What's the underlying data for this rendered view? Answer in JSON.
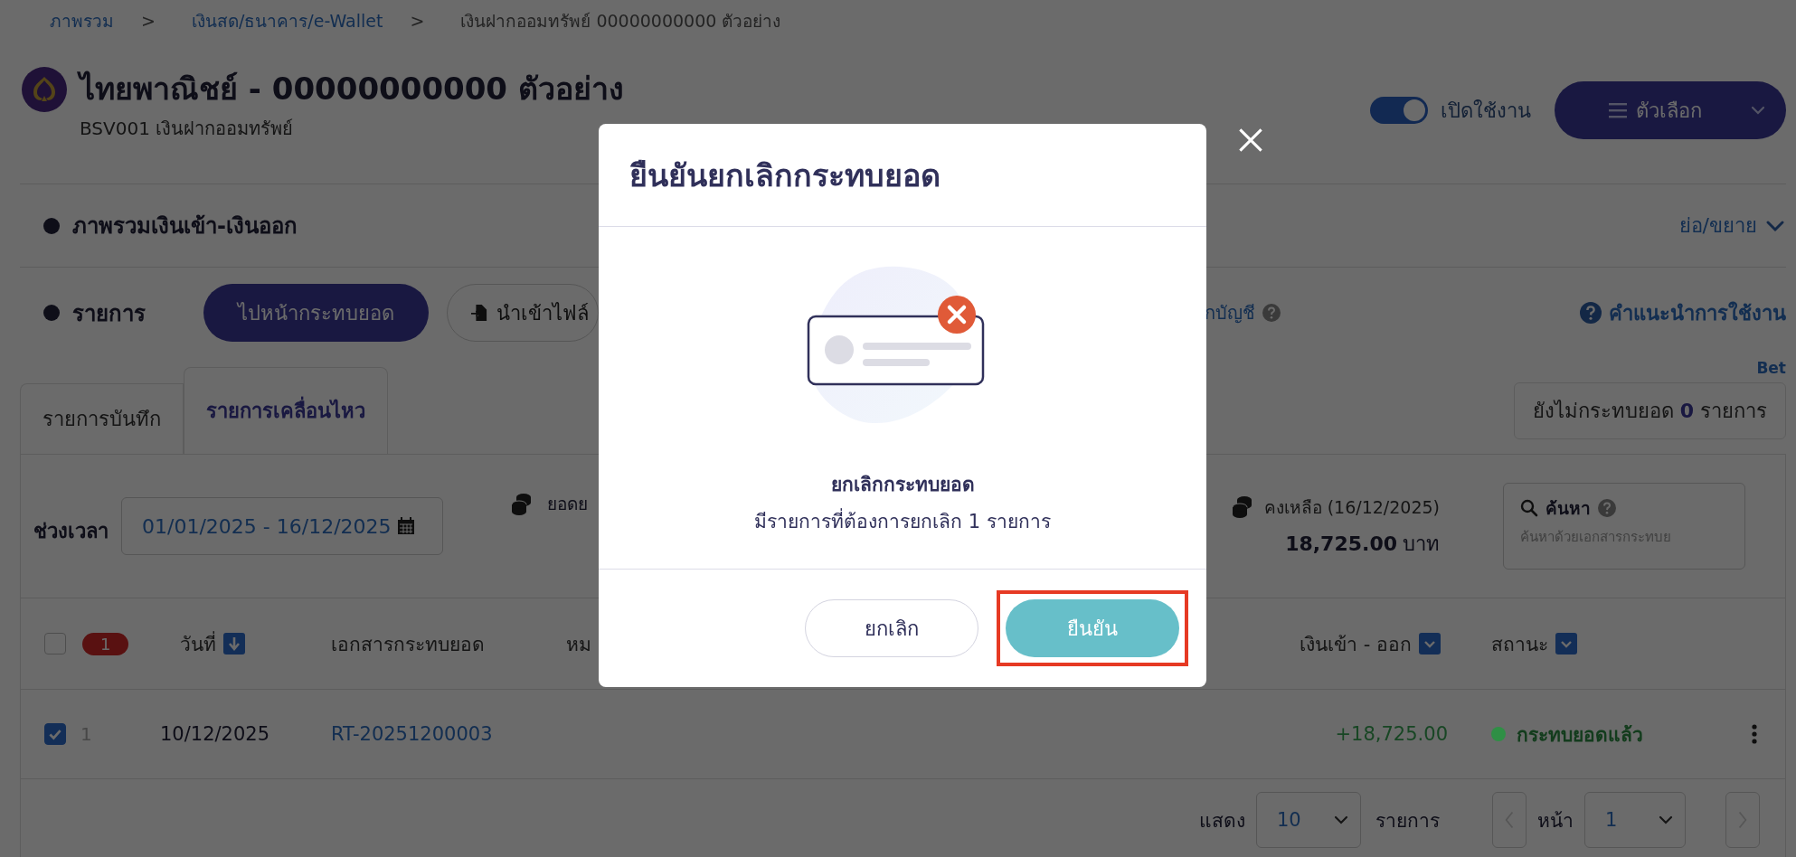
{
  "breadcrumb": [
    {
      "label": "ภาพรวม",
      "link": true
    },
    {
      "label": "เงินสด/ธนาคาร/e-Wallet",
      "link": true,
      "separator": ">"
    },
    {
      "label": "เงินฝากออมทรัพย์ 00000000000 ตัวอย่าง",
      "link": false,
      "separator": ">"
    }
  ],
  "account": {
    "title": "ไทยพาณิชย์ - 00000000000 ตัวอย่าง",
    "subtitle": "BSV001 เงินฝากออมทรัพย์"
  },
  "status_toggle": {
    "label": "เปิดใช้งาน",
    "on": true
  },
  "options_button": {
    "label": "ตัวเลือก"
  },
  "overview_section": {
    "title": "ภาพรวมเงินเข้า-เงินออก",
    "toggle_label": "ย่อ/ขยาย"
  },
  "transactions_section": {
    "title": "รายการ",
    "actions": [
      {
        "label": "ไปหน้ากระทบยอด",
        "kind": "primary"
      },
      {
        "label": "นำเข้าไฟล์",
        "kind": "import"
      }
    ],
    "partial_link": "กบัญชี",
    "help_link": "คำแนะนำการใช้งาน",
    "beta_label": "Bet"
  },
  "tabs": [
    {
      "label": "รายการบันทึก",
      "selected": false
    },
    {
      "label": "รายการเคลื่อนไหว",
      "selected": true
    }
  ],
  "unreconciled": {
    "prefix": "ยังไม่กระทบยอด",
    "count": "0",
    "suffix": "รายการ"
  },
  "filters": {
    "period_label": "ช่วงเวลา",
    "period_value": "01/01/2025 - 16/12/2025",
    "summary_partial": "ยอดย",
    "balance_label": "คงเหลือ (16/12/2025)",
    "balance_amount": "18,725.00",
    "balance_unit": "บาท",
    "search_label": "ค้นหา",
    "search_placeholder": "ค้นหาด้วยเอกสารกระทบย"
  },
  "table": {
    "select_all_checked": false,
    "selected_count": "1",
    "columns": [
      {
        "label": "วันที่",
        "kind": "sort"
      },
      {
        "label": "เอกสารกระทบยอด",
        "kind": "plain"
      },
      {
        "label": "หม",
        "kind": "plain"
      },
      {
        "label": "เงินเข้า - ออก",
        "kind": "dropdown"
      },
      {
        "label": "สถานะ",
        "kind": "dropdown"
      }
    ],
    "rows": [
      {
        "checked": true,
        "index": "1",
        "date": "10/12/2025",
        "document": "RT-20251200003",
        "amount": "+18,725.00",
        "status": {
          "label": "กระทบยอดแล้ว",
          "color": "#2f8f45"
        }
      }
    ]
  },
  "pagination": {
    "show_label": "แสดง",
    "page_size": "10",
    "items_label": "รายการ",
    "page_label": "หน้า",
    "page": "1"
  },
  "dialog": {
    "title": "ยืนยันยกเลิกกระทบยอด",
    "message_title": "ยกเลิกกระทบยอด",
    "message": "มีรายการที่ต้องการยกเลิก 1 รายการ",
    "buttons": [
      {
        "label": "ยกเลิก",
        "kind": "secondary",
        "highlighted": false
      },
      {
        "label": "ยืนยัน",
        "kind": "primary",
        "highlighted": true
      }
    ]
  }
}
